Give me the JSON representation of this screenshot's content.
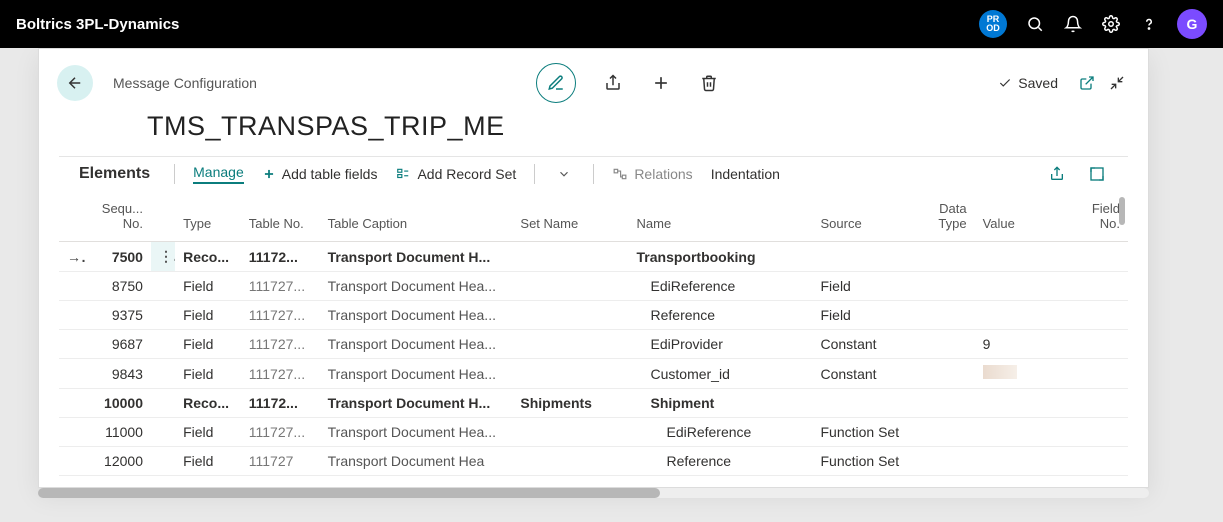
{
  "topbar": {
    "brand": "Boltrics 3PL-Dynamics",
    "env_badge": "PR\nOD",
    "avatar_initial": "G"
  },
  "header": {
    "crumb": "Message Configuration",
    "saved_label": "Saved",
    "title": "TMS_TRANSPAS_TRIP_ME"
  },
  "toolbar": {
    "section": "Elements",
    "manage": "Manage",
    "add_table_fields": "Add table fields",
    "add_record_set": "Add Record Set",
    "relations": "Relations",
    "indentation": "Indentation"
  },
  "columns": {
    "seq": "Sequ... No.",
    "type": "Type",
    "table_no": "Table No.",
    "table_caption": "Table Caption",
    "set_name": "Set Name",
    "name": "Name",
    "source": "Source",
    "data_type": "Data Type",
    "value": "Value",
    "field_no": "Field No."
  },
  "rows": [
    {
      "mark": "→",
      "seq": "7500",
      "menu": "⋮",
      "type": "Reco...",
      "table_no": "11172...",
      "caption": "Transport Document H...",
      "caption_bold": true,
      "set": "",
      "name": "Transportbooking",
      "name_indent": 0,
      "src": "",
      "val": "",
      "bold": true
    },
    {
      "mark": "",
      "seq": "8750",
      "menu": "",
      "type": "Field",
      "table_no": "111727...",
      "caption": "Transport Document Hea...",
      "caption_bold": false,
      "set": "",
      "name": "EdiReference",
      "name_indent": 1,
      "src": "Field",
      "val": "",
      "bold": false
    },
    {
      "mark": "",
      "seq": "9375",
      "menu": "",
      "type": "Field",
      "table_no": "111727...",
      "caption": "Transport Document Hea...",
      "caption_bold": false,
      "set": "",
      "name": "Reference",
      "name_indent": 1,
      "src": "Field",
      "val": "",
      "bold": false
    },
    {
      "mark": "",
      "seq": "9687",
      "menu": "",
      "type": "Field",
      "table_no": "111727...",
      "caption": "Transport Document Hea...",
      "caption_bold": false,
      "set": "",
      "name": "EdiProvider",
      "name_indent": 1,
      "src": "Constant",
      "val": "9",
      "bold": false
    },
    {
      "mark": "",
      "seq": "9843",
      "menu": "",
      "type": "Field",
      "table_no": "111727...",
      "caption": "Transport Document Hea...",
      "caption_bold": false,
      "set": "",
      "name": "Customer_id",
      "name_indent": 1,
      "src": "Constant",
      "val": "__SWATCH__",
      "bold": false
    },
    {
      "mark": "",
      "seq": "10000",
      "menu": "",
      "type": "Reco...",
      "table_no": "11172...",
      "caption": "Transport Document H...",
      "caption_bold": true,
      "set": "Shipments",
      "name": "Shipment",
      "name_indent": 1,
      "src": "",
      "val": "",
      "bold": true
    },
    {
      "mark": "",
      "seq": "11000",
      "menu": "",
      "type": "Field",
      "table_no": "111727...",
      "caption": "Transport Document Hea...",
      "caption_bold": false,
      "set": "",
      "name": "EdiReference",
      "name_indent": 2,
      "src": "Function Set",
      "val": "",
      "bold": false
    },
    {
      "mark": "",
      "seq": "12000",
      "menu": "",
      "type": "Field",
      "table_no": "111727",
      "caption": "Transport Document Hea",
      "caption_bold": false,
      "set": "",
      "name": "Reference",
      "name_indent": 2,
      "src": "Function Set",
      "val": "",
      "bold": false
    }
  ]
}
